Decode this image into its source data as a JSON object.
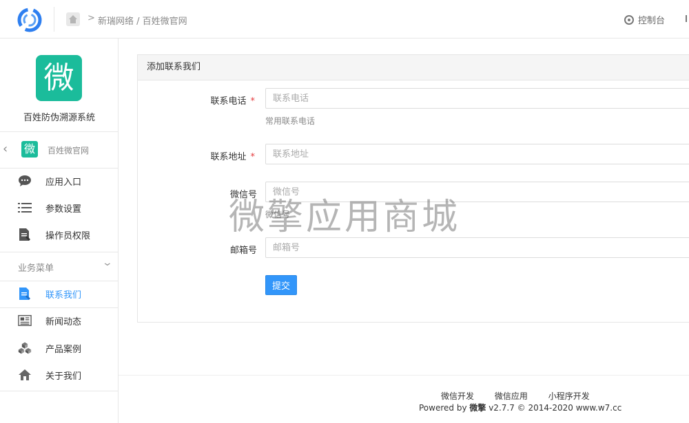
{
  "header": {
    "breadcrumb": "新瑞网络 / 百姓微官网",
    "console_label": "控制台"
  },
  "sidebar": {
    "app_logo_char": "微",
    "app_name": "百姓防伪溯源系统",
    "account_logo_char": "微",
    "account_name": "百姓微官网",
    "items": [
      {
        "label": "应用入口",
        "icon": "chat-bubble-icon"
      },
      {
        "label": "参数设置",
        "icon": "list-settings-icon"
      },
      {
        "label": "操作员权限",
        "icon": "document-edit-icon"
      }
    ],
    "section_title": "业务菜单",
    "business_items": [
      {
        "label": "联系我们",
        "icon": "document-edit-icon",
        "active": true
      },
      {
        "label": "新闻动态",
        "icon": "newspaper-icon"
      },
      {
        "label": "产品案例",
        "icon": "cubes-icon"
      },
      {
        "label": "关于我们",
        "icon": "home-icon"
      }
    ]
  },
  "panel": {
    "title": "添加联系我们",
    "fields": [
      {
        "label": "联系电话",
        "required": true,
        "placeholder": "联系电话",
        "help": "常用联系电话"
      },
      {
        "label": "联系地址",
        "required": true,
        "placeholder": "联系地址",
        "help": ""
      },
      {
        "label": "微信号",
        "required": false,
        "placeholder": "微信号",
        "help": "微信号"
      },
      {
        "label": "邮箱号",
        "required": false,
        "placeholder": "邮箱号",
        "help": ""
      }
    ],
    "submit_label": "提交"
  },
  "watermark": "微擎应用商城",
  "footer": {
    "links": [
      "微信开发",
      "微信应用",
      "小程序开发"
    ],
    "powered_prefix": "Powered by ",
    "powered_brand": "微擎",
    "powered_suffix": " v2.7.7 © 2014-2020 www.w7.cc"
  },
  "colors": {
    "accent": "#3296fa",
    "brand_green": "#1bbc9b",
    "required": "#e4393c"
  }
}
